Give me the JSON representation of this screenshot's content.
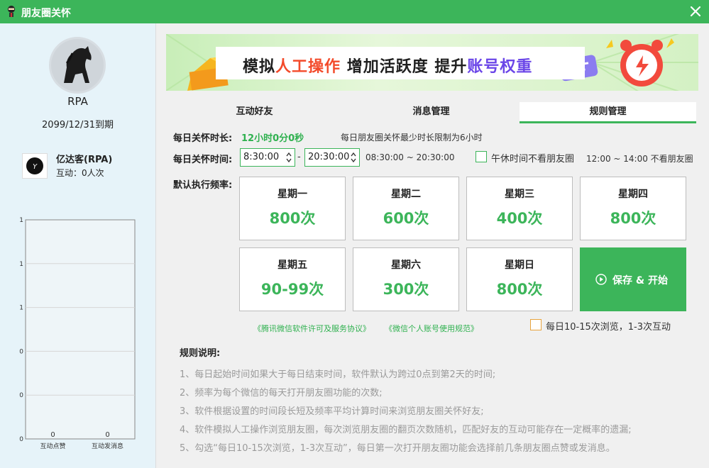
{
  "window": {
    "title": "朋友圈关怀"
  },
  "sidebar": {
    "username": "RPA",
    "expiry": "2099/12/31到期",
    "account": {
      "name": "亿达客(RPA)",
      "interaction_label": "互动：",
      "interaction_value": "0人次"
    }
  },
  "banner": {
    "part1": "模拟",
    "part2": "人工操作",
    "part3": " 增加活跃度 提升",
    "part4": "账号权重"
  },
  "tabs": [
    {
      "label": "互动好友",
      "active": false
    },
    {
      "label": "消息管理",
      "active": false
    },
    {
      "label": "规则管理",
      "active": true
    }
  ],
  "settings": {
    "duration_label": "每日关怀时长:",
    "duration_value": "12小时0分0秒",
    "duration_note": "每日朋友圈关怀最少时长限制为6小时",
    "time_label": "每日关怀时间:",
    "time_start": "8:30:00",
    "time_dash": "-",
    "time_end": "20:30:00",
    "time_range": "08:30:00 ~ 20:30:00",
    "nap_label": "午休时间不看朋友圈",
    "nap_range": "12:00 ~ 14:00 不看朋友圈",
    "freq_label": "默认执行频率:"
  },
  "days": [
    {
      "name": "星期一",
      "value": "800次"
    },
    {
      "name": "星期二",
      "value": "600次"
    },
    {
      "name": "星期三",
      "value": "400次"
    },
    {
      "name": "星期四",
      "value": "800次"
    },
    {
      "name": "星期五",
      "value": "90-99次"
    },
    {
      "name": "星期六",
      "value": "300次"
    },
    {
      "name": "星期日",
      "value": "800次"
    }
  ],
  "save_button": "保存 & 开始",
  "links": {
    "license": "《腾讯微信软件许可及服务协议》",
    "rules": "《微信个人账号使用规范》"
  },
  "browse_option": "每日10-15次浏览，1-3次互动",
  "rules": {
    "title": "规则说明:",
    "items": [
      "1、每日起始时间如果大于每日结束时间，软件默认为跨过0点到第2天的时间;",
      "2、频率为每个微信的每天打开朋友圈功能的次数;",
      "3、软件根据设置的时间段长短及频率平均计算时间来浏览朋友圈关怀好友;",
      "4、软件模拟人工操作浏览朋友圈，每次浏览朋友圈的翻页次数随机，匹配好友的互动可能存在一定概率的遗漏;",
      "5、勾选“每日10-15次浏览，1-3次互动”，每日第一次打开朋友圈功能会选择前几条朋友圈点赞或发消息。"
    ]
  },
  "chart_data": {
    "type": "bar",
    "categories": [
      "互动点赞",
      "互动发消息"
    ],
    "values": [
      0,
      0
    ],
    "data_labels": [
      "0",
      "0"
    ],
    "y_tick_labels": [
      "1",
      "1",
      "1",
      "0",
      "0",
      "0"
    ],
    "ylim": [
      0,
      1
    ],
    "grid": true
  },
  "colors": {
    "accent": "#3cb55a",
    "sidebar_bg": "#e6f3f9",
    "highlight_red": "#f34b2b",
    "highlight_purple": "#6b46e8"
  }
}
